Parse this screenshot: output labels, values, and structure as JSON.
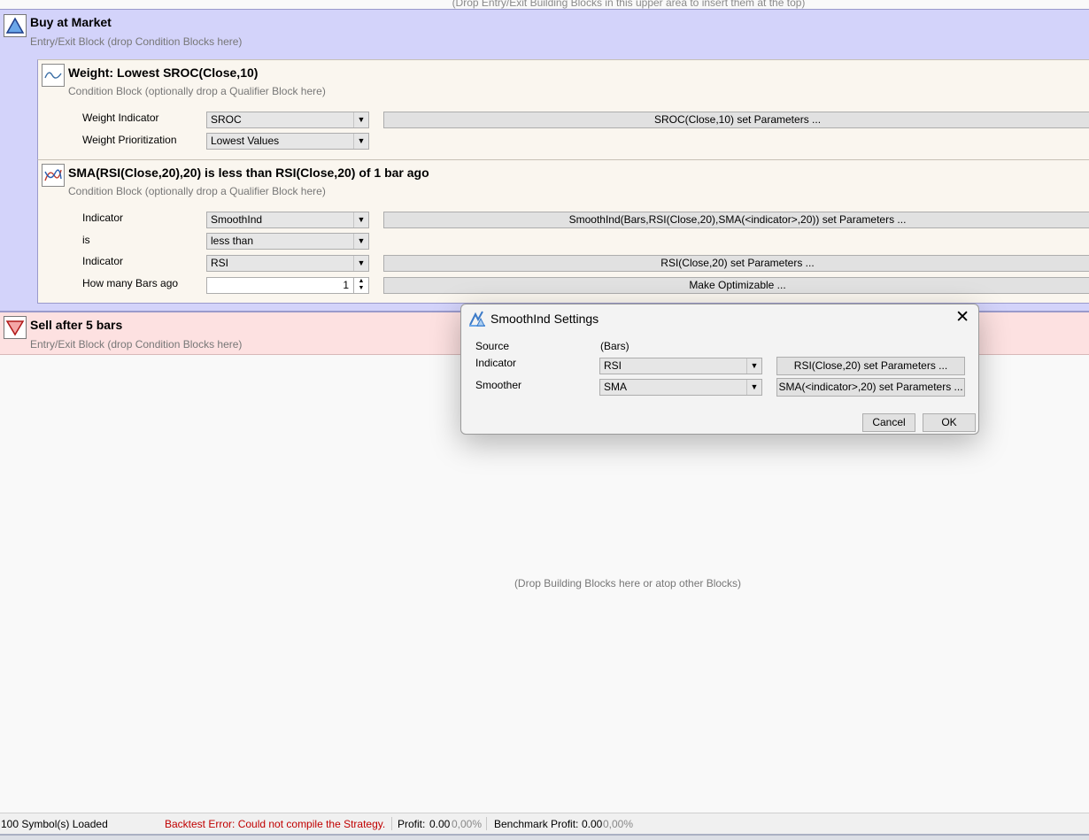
{
  "top_hint": "(Drop Entry/Exit Building Blocks in this upper area to insert them at the top)",
  "buy_block": {
    "title": "Buy at Market",
    "subtitle": "Entry/Exit Block (drop Condition Blocks here)",
    "icon": "triangle-up-icon",
    "color": "#d3d3fa"
  },
  "weight_block": {
    "title": "Weight: Lowest SROC(Close,10)",
    "subtitle": "Condition Block (optionally drop a Qualifier Block here)",
    "icon": "wave-icon",
    "rows": [
      {
        "label": "Weight Indicator",
        "value": "SROC",
        "button": "SROC(Close,10) set Parameters ..."
      },
      {
        "label": "Weight Prioritization",
        "value": "Lowest Values"
      }
    ]
  },
  "sma_block": {
    "title": "SMA(RSI(Close,20),20) is less than RSI(Close,20) of 1 bar ago",
    "subtitle": "Condition Block (optionally drop a Qualifier Block here)",
    "icon": "crossing-lines-icon",
    "indicator1_label": "Indicator",
    "indicator1_value": "SmoothInd",
    "indicator1_button": "SmoothInd(Bars,RSI(Close,20),SMA(<indicator>,20)) set Parameters ...",
    "is_label": "is",
    "is_value": "less than",
    "indicator2_label": "Indicator",
    "indicator2_value": "RSI",
    "indicator2_button": "RSI(Close,20) set Parameters ...",
    "bars_ago_label": "How many Bars ago",
    "bars_ago_value": "1",
    "optimizable_button": "Make Optimizable ..."
  },
  "sell_block": {
    "title": "Sell after 5 bars",
    "subtitle": "Entry/Exit Block (drop Condition Blocks here)",
    "icon": "triangle-down-icon",
    "color": "#fde1e1"
  },
  "drop_hint": "(Drop Building Blocks here or atop other Blocks)",
  "status": {
    "symbols": "100 Symbol(s) Loaded",
    "error": "Backtest Error: Could not compile the Strategy.",
    "profit_label": "Profit:",
    "profit_value": "0.00",
    "profit_pct": "0,00%",
    "benchmark_label": "Benchmark Profit:",
    "benchmark_value": "0.00",
    "benchmark_pct": "0,00%",
    "error_color": "#c00000"
  },
  "dialog": {
    "title": "SmoothInd Settings",
    "icon": "app-icon",
    "source_label": "Source",
    "source_value": "(Bars)",
    "indicator_label": "Indicator",
    "indicator_value": "RSI",
    "indicator_button": "RSI(Close,20) set Parameters ...",
    "smoother_label": "Smoother",
    "smoother_value": "SMA",
    "smoother_button": "SMA(<indicator>,20) set Parameters ...",
    "cancel": "Cancel",
    "ok": "OK"
  }
}
